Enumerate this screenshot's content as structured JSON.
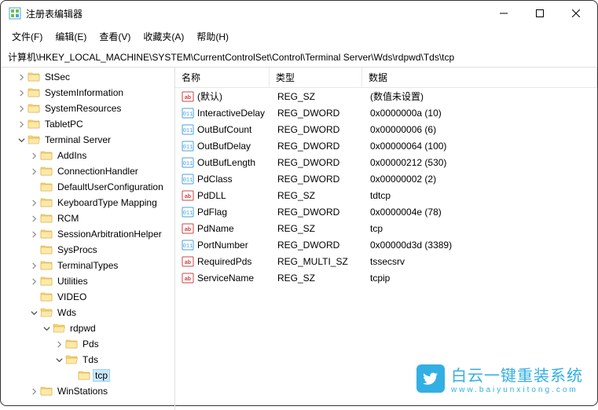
{
  "window": {
    "title": "注册表编辑器"
  },
  "menu": {
    "file": "文件(F)",
    "edit": "编辑(E)",
    "view": "查看(V)",
    "favorites": "收藏夹(A)",
    "help": "帮助(H)"
  },
  "address": "计算机\\HKEY_LOCAL_MACHINE\\SYSTEM\\CurrentControlSet\\Control\\Terminal Server\\Wds\\rdpwd\\Tds\\tcp",
  "columns": {
    "name": "名称",
    "type": "类型",
    "data": "数据"
  },
  "tree": [
    {
      "label": "StSec",
      "indent": 3,
      "exp": "closed"
    },
    {
      "label": "SystemInformation",
      "indent": 3,
      "exp": "closed"
    },
    {
      "label": "SystemResources",
      "indent": 3,
      "exp": "closed"
    },
    {
      "label": "TabletPC",
      "indent": 3,
      "exp": "closed"
    },
    {
      "label": "Terminal Server",
      "indent": 3,
      "exp": "open"
    },
    {
      "label": "AddIns",
      "indent": 4,
      "exp": "closed"
    },
    {
      "label": "ConnectionHandler",
      "indent": 4,
      "exp": "closed"
    },
    {
      "label": "DefaultUserConfiguration",
      "indent": 4,
      "exp": "none"
    },
    {
      "label": "KeyboardType Mapping",
      "indent": 4,
      "exp": "closed"
    },
    {
      "label": "RCM",
      "indent": 4,
      "exp": "closed"
    },
    {
      "label": "SessionArbitrationHelper",
      "indent": 4,
      "exp": "closed"
    },
    {
      "label": "SysProcs",
      "indent": 4,
      "exp": "none"
    },
    {
      "label": "TerminalTypes",
      "indent": 4,
      "exp": "closed"
    },
    {
      "label": "Utilities",
      "indent": 4,
      "exp": "closed"
    },
    {
      "label": "VIDEO",
      "indent": 4,
      "exp": "none"
    },
    {
      "label": "Wds",
      "indent": 4,
      "exp": "open"
    },
    {
      "label": "rdpwd",
      "indent": 5,
      "exp": "open"
    },
    {
      "label": "Pds",
      "indent": 6,
      "exp": "closed"
    },
    {
      "label": "Tds",
      "indent": 6,
      "exp": "open"
    },
    {
      "label": "tcp",
      "indent": 7,
      "exp": "none",
      "selected": true
    },
    {
      "label": "WinStations",
      "indent": 4,
      "exp": "closed"
    }
  ],
  "values": [
    {
      "name": "(默认)",
      "type": "REG_SZ",
      "data": "(数值未设置)",
      "icon": "sz"
    },
    {
      "name": "InteractiveDelay",
      "type": "REG_DWORD",
      "data": "0x0000000a (10)",
      "icon": "bin"
    },
    {
      "name": "OutBufCount",
      "type": "REG_DWORD",
      "data": "0x00000006 (6)",
      "icon": "bin"
    },
    {
      "name": "OutBufDelay",
      "type": "REG_DWORD",
      "data": "0x00000064 (100)",
      "icon": "bin"
    },
    {
      "name": "OutBufLength",
      "type": "REG_DWORD",
      "data": "0x00000212 (530)",
      "icon": "bin"
    },
    {
      "name": "PdClass",
      "type": "REG_DWORD",
      "data": "0x00000002 (2)",
      "icon": "bin"
    },
    {
      "name": "PdDLL",
      "type": "REG_SZ",
      "data": "tdtcp",
      "icon": "sz"
    },
    {
      "name": "PdFlag",
      "type": "REG_DWORD",
      "data": "0x0000004e (78)",
      "icon": "bin"
    },
    {
      "name": "PdName",
      "type": "REG_SZ",
      "data": "tcp",
      "icon": "sz"
    },
    {
      "name": "PortNumber",
      "type": "REG_DWORD",
      "data": "0x00000d3d (3389)",
      "icon": "bin"
    },
    {
      "name": "RequiredPds",
      "type": "REG_MULTI_SZ",
      "data": "tssecsrv",
      "icon": "sz"
    },
    {
      "name": "ServiceName",
      "type": "REG_SZ",
      "data": "tcpip",
      "icon": "sz"
    }
  ],
  "watermark": {
    "text": "白云一键重装系统",
    "sub": "www.baiyunxitong.com"
  }
}
